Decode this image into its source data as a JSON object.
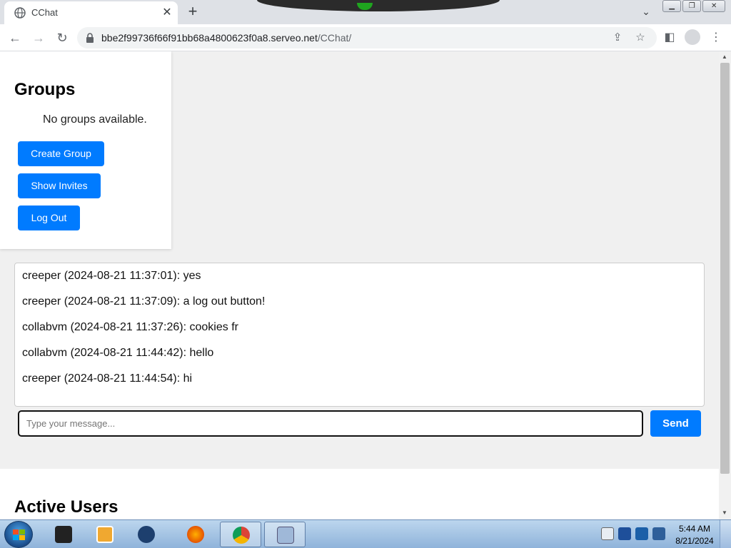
{
  "browser": {
    "tab_title": "CChat",
    "tab_close": "✕",
    "new_tab": "+",
    "url_host": "bbe2f99736f66f91bb68a4800623f0a8.serveo.net",
    "url_path": "/CChat/"
  },
  "groups": {
    "heading": "Groups",
    "empty_text": "No groups available.",
    "create_label": "Create Group",
    "invites_label": "Show Invites",
    "logout_label": "Log Out"
  },
  "messages": [
    {
      "text": "creeper (2024-08-21 11:37:01): yes"
    },
    {
      "text": "creeper (2024-08-21 11:37:09): a log out button!"
    },
    {
      "text": "collabvm (2024-08-21 11:37:26): cookies fr"
    },
    {
      "text": "collabvm (2024-08-21 11:44:42): hello"
    },
    {
      "text": "creeper (2024-08-21 11:44:54): hi"
    }
  ],
  "composer": {
    "placeholder": "Type your message...",
    "send_label": "Send"
  },
  "users": {
    "heading": "Active Users"
  },
  "taskbar": {
    "time": "5:44 AM",
    "date": "8/21/2024"
  },
  "colors": {
    "accent": "#007bff",
    "page_bg": "#f0f0f0"
  }
}
